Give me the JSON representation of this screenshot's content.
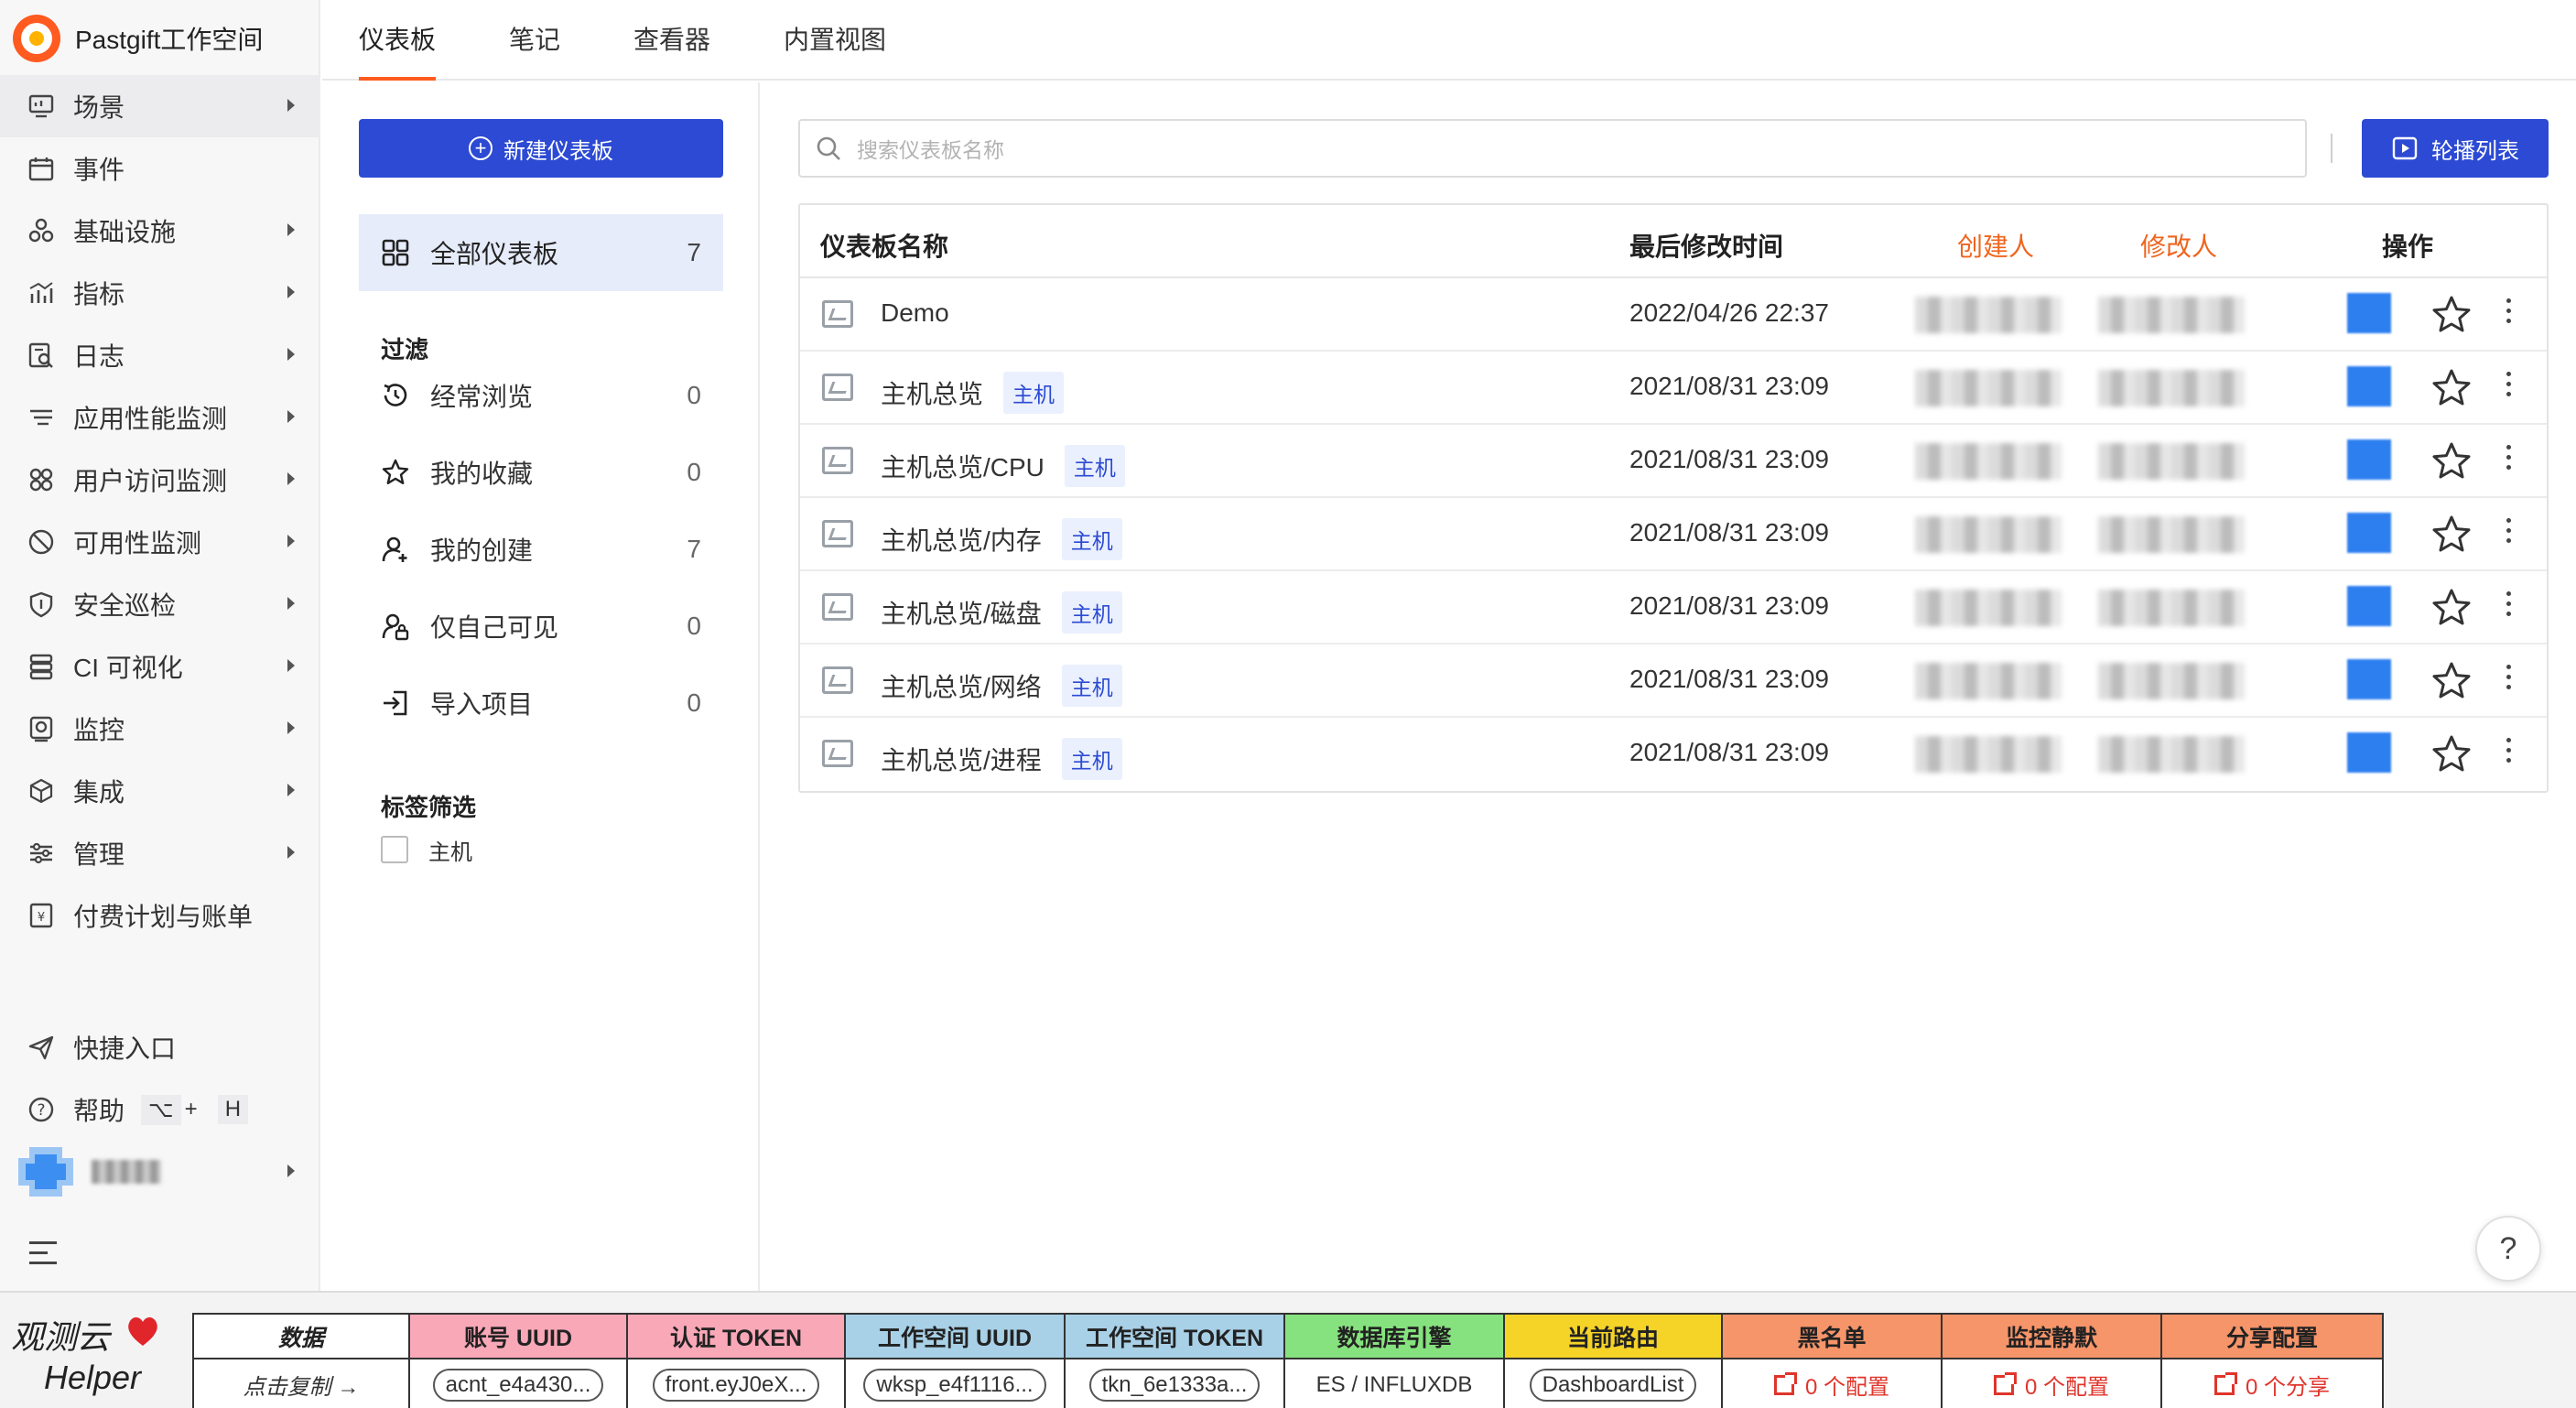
{
  "brand": {
    "name": "Pastgift工作空间"
  },
  "sidebar": {
    "items": [
      {
        "label": "场景",
        "icon": "scene-icon",
        "arrow": true,
        "active": true
      },
      {
        "label": "事件",
        "icon": "calendar-icon",
        "arrow": false
      },
      {
        "label": "基础设施",
        "icon": "infrastructure-icon",
        "arrow": true
      },
      {
        "label": "指标",
        "icon": "metrics-chart-icon",
        "arrow": true
      },
      {
        "label": "日志",
        "icon": "log-search-icon",
        "arrow": true
      },
      {
        "label": "应用性能监测",
        "icon": "apm-icon",
        "arrow": true
      },
      {
        "label": "用户访问监测",
        "icon": "rum-icon",
        "arrow": true
      },
      {
        "label": "可用性监测",
        "icon": "availability-icon",
        "arrow": true
      },
      {
        "label": "安全巡检",
        "icon": "shield-icon",
        "arrow": true
      },
      {
        "label": "CI 可视化",
        "icon": "ci-icon",
        "arrow": true
      },
      {
        "label": "监控",
        "icon": "monitor-icon",
        "arrow": true
      },
      {
        "label": "集成",
        "icon": "integration-cube-icon",
        "arrow": true
      },
      {
        "label": "管理",
        "icon": "settings-sliders-icon",
        "arrow": true
      },
      {
        "label": "付费计划与账单",
        "icon": "billing-icon",
        "arrow": false
      }
    ],
    "bottom": {
      "shortcut_label": "快捷入口",
      "help_label": "帮助",
      "help_key_1": "⌥",
      "help_key_plus": "+",
      "help_key_2": "H"
    }
  },
  "tabs": [
    {
      "label": "仪表板",
      "active": true
    },
    {
      "label": "笔记",
      "active": false
    },
    {
      "label": "查看器",
      "active": false
    },
    {
      "label": "内置视图",
      "active": false
    }
  ],
  "filters": {
    "new_button": "新建仪表板",
    "all_label": "全部仪表板",
    "all_count": "7",
    "filter_title": "过滤",
    "items": [
      {
        "label": "经常浏览",
        "count": "0",
        "icon": "history-icon"
      },
      {
        "label": "我的收藏",
        "count": "0",
        "icon": "star-icon"
      },
      {
        "label": "我的创建",
        "count": "7",
        "icon": "user-add-icon"
      },
      {
        "label": "仅自己可见",
        "count": "0",
        "icon": "user-lock-icon"
      },
      {
        "label": "导入项目",
        "count": "0",
        "icon": "import-icon"
      }
    ],
    "tag_title": "标签筛选",
    "tags": [
      {
        "label": "主机",
        "checked": false
      }
    ]
  },
  "search": {
    "placeholder": "搜索仪表板名称"
  },
  "carousel_button": "轮播列表",
  "table": {
    "headers": {
      "name": "仪表板名称",
      "modified": "最后修改时间",
      "creator": "创建人",
      "modifier": "修改人",
      "actions": "操作"
    },
    "rows": [
      {
        "name": "Demo",
        "tag": "",
        "time": "2022/04/26 22:37"
      },
      {
        "name": "主机总览",
        "tag": "主机",
        "time": "2021/08/31 23:09"
      },
      {
        "name": "主机总览/CPU",
        "tag": "主机",
        "time": "2021/08/31 23:09"
      },
      {
        "name": "主机总览/内存",
        "tag": "主机",
        "time": "2021/08/31 23:09"
      },
      {
        "name": "主机总览/磁盘",
        "tag": "主机",
        "time": "2021/08/31 23:09"
      },
      {
        "name": "主机总览/网络",
        "tag": "主机",
        "time": "2021/08/31 23:09"
      },
      {
        "name": "主机总览/进程",
        "tag": "主机",
        "time": "2021/08/31 23:09"
      }
    ]
  },
  "help_button": "?",
  "helper": {
    "brand_line1": "观测云",
    "brand_line2": "Helper",
    "columns": [
      {
        "header": "数据",
        "value": "点击复制 →",
        "color": "#ffffff",
        "pill": false,
        "link": false
      },
      {
        "header": "账号 UUID",
        "value": "acnt_e4a430...",
        "color": "#f9a8b8",
        "pill": true,
        "link": false
      },
      {
        "header": "认证 TOKEN",
        "value": "front.eyJ0eX...",
        "color": "#f9a8b8",
        "pill": true,
        "link": false
      },
      {
        "header": "工作空间 UUID",
        "value": "wksp_e4f1116...",
        "color": "#a8d0e6",
        "pill": true,
        "link": false
      },
      {
        "header": "工作空间 TOKEN",
        "value": "tkn_6e1333a...",
        "color": "#a8d0e6",
        "pill": true,
        "link": false
      },
      {
        "header": "数据库引擎",
        "value": "ES / INFLUXDB",
        "color": "#86e27e",
        "pill": false,
        "link": false
      },
      {
        "header": "当前路由",
        "value": "DashboardList",
        "color": "#f5d327",
        "pill": true,
        "link": false
      },
      {
        "header": "黑名单",
        "value": "0 个配置",
        "color": "#f6946a",
        "pill": false,
        "link": true
      },
      {
        "header": "监控静默",
        "value": "0 个配置",
        "color": "#f6946a",
        "pill": false,
        "link": true
      },
      {
        "header": "分享配置",
        "value": "0 个分享",
        "color": "#f6946a",
        "pill": false,
        "link": true
      }
    ]
  }
}
